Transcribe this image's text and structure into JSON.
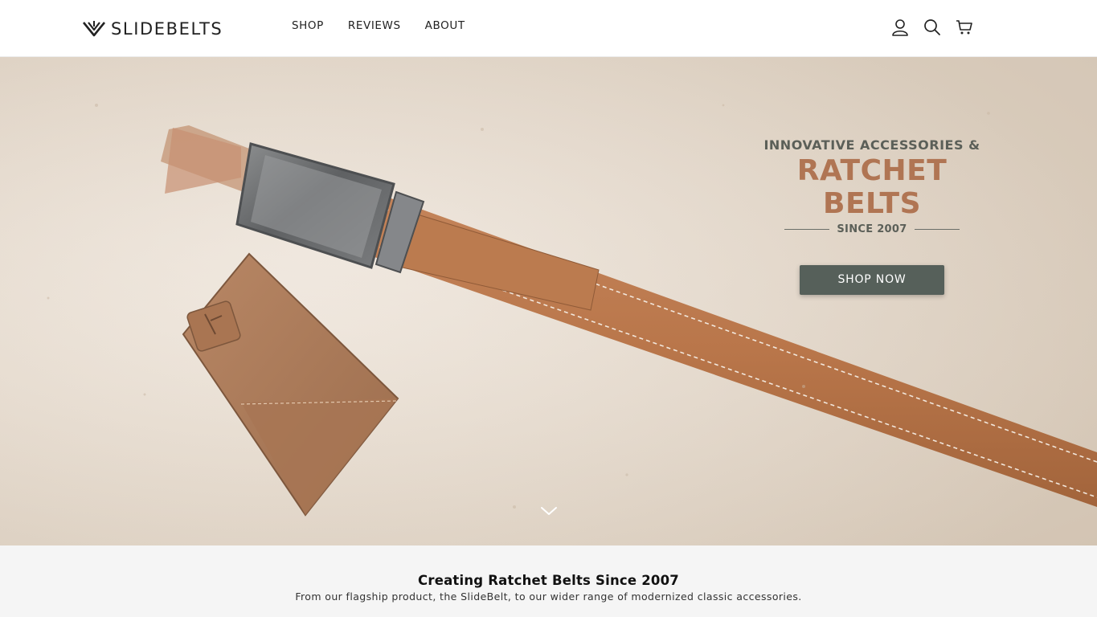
{
  "brand": {
    "name": "SLIDEBELTS",
    "logo_icon": "slidebelts-mark-icon"
  },
  "nav": {
    "items": [
      {
        "label": "SHOP"
      },
      {
        "label": "REVIEWS"
      },
      {
        "label": "ABOUT"
      }
    ]
  },
  "header_icons": [
    "account-icon",
    "search-icon",
    "cart-icon"
  ],
  "hero": {
    "eyebrow": "INNOVATIVE ACCESSORIES &",
    "headline": "RATCHET BELTS",
    "since": "SINCE 2007",
    "cta_label": "SHOP NOW",
    "scroll_icon": "chevron-down-icon",
    "colors": {
      "headline": "#b07553",
      "cta_bg": "#56605a",
      "sand": "#e7dccf",
      "leather": "#b9764a"
    }
  },
  "intro": {
    "title": "Creating Ratchet Belts Since 2007",
    "subtitle": "From our flagship product, the SlideBelt, to our wider range of modernized classic accessories."
  }
}
